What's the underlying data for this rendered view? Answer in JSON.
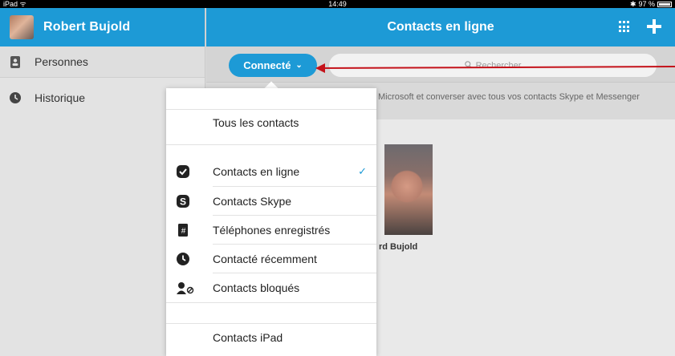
{
  "status_bar": {
    "device": "iPad",
    "time": "14:49",
    "bluetooth": "✱",
    "battery": "97 %",
    "battery_level": 0.97
  },
  "sidebar": {
    "profile_name": "Robert  Bujold",
    "items": [
      {
        "label": "Personnes",
        "icon": "contact-card-icon"
      },
      {
        "label": "Historique",
        "icon": "clock-icon"
      }
    ]
  },
  "header": {
    "title": "Contacts en ligne",
    "dialpad_icon": "dialpad-icon",
    "add_icon": "plus-icon"
  },
  "toolbar": {
    "status_label": "Connecté",
    "status_chevron": "⌄",
    "search_placeholder": "Rechercher"
  },
  "banner": {
    "text": "Microsoft et converser avec tous vos contacts Skype et Messenger"
  },
  "contact": {
    "name": "rd Bujold"
  },
  "menu": {
    "items": [
      {
        "label": "Tous les contacts",
        "icon": ""
      },
      {
        "label": "Contacts en ligne",
        "icon": "online-contacts-icon",
        "selected": true
      },
      {
        "label": "Contacts Skype",
        "icon": "skype-icon"
      },
      {
        "label": "Téléphones enregistrés",
        "icon": "phone-book-icon"
      },
      {
        "label": "Contacté récemment",
        "icon": "clock-icon"
      },
      {
        "label": "Contacts bloqués",
        "icon": "blocked-contacts-icon"
      },
      {
        "label": "Contacts iPad",
        "icon": ""
      }
    ],
    "check_glyph": "✓"
  },
  "colors": {
    "accent": "#1d9ad6",
    "annotation_arrow": "#c4121a"
  }
}
